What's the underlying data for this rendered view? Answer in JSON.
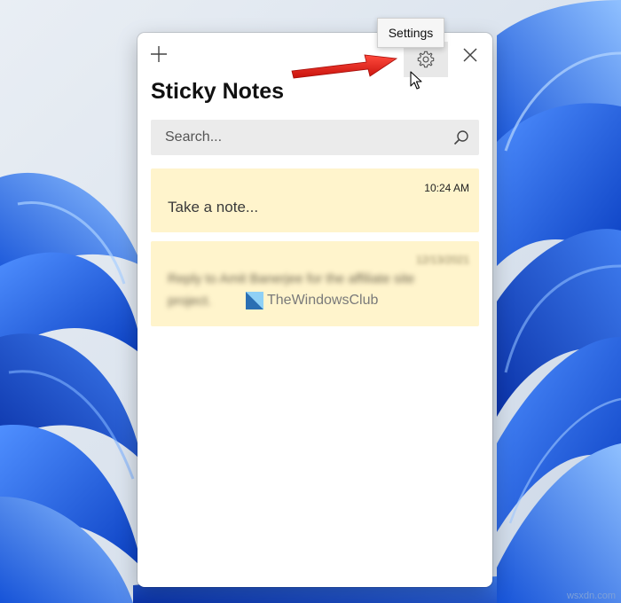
{
  "window": {
    "title": "Sticky Notes",
    "new_note_icon": "plus-icon",
    "settings_icon": "gear-icon",
    "close_icon": "close-icon"
  },
  "tooltip": {
    "label": "Settings"
  },
  "search": {
    "placeholder": "Search...",
    "icon": "search-icon"
  },
  "notes": [
    {
      "time": "10:24 AM",
      "text": "Take a note...",
      "color": "#fff4cc"
    },
    {
      "time": "12/13/2021",
      "text": "Reply to Amit Banerjee for the affiliate site project.",
      "color": "#fff4cc",
      "blurred": true
    }
  ],
  "watermark": {
    "text": "TheWindowsClub"
  },
  "annotation": {
    "arrow_color": "#e8231b"
  },
  "site_watermark": "wsxdn.com"
}
